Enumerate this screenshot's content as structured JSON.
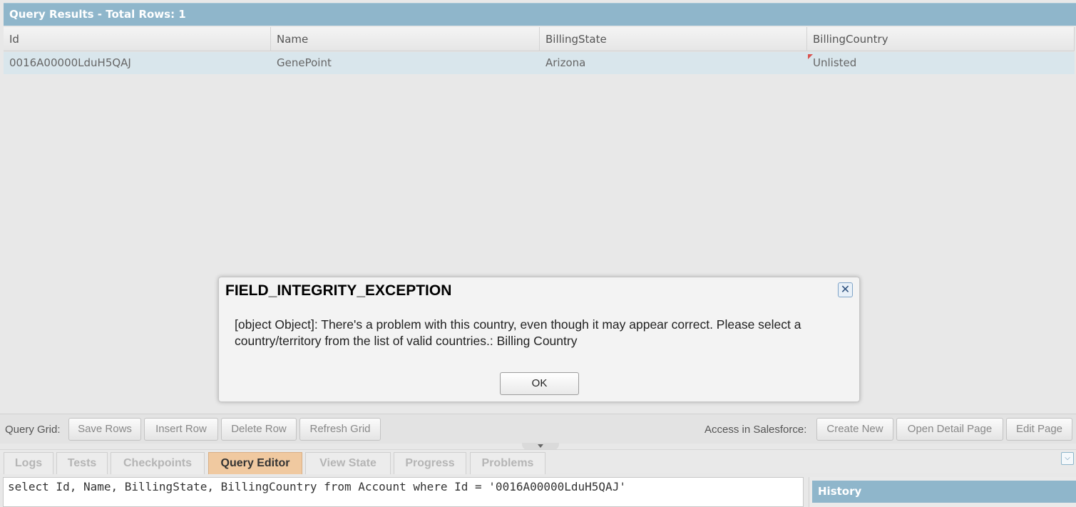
{
  "results": {
    "title": "Query Results - Total Rows: 1",
    "columns": [
      "Id",
      "Name",
      "BillingState",
      "BillingCountry"
    ],
    "rows": [
      [
        "0016A00000LduH5QAJ",
        "GenePoint",
        "Arizona",
        "Unlisted"
      ]
    ]
  },
  "toolbar": {
    "query_grid_label": "Query Grid:",
    "save_rows": "Save Rows",
    "insert_row": "Insert Row",
    "delete_row": "Delete Row",
    "refresh_grid": "Refresh Grid",
    "access_label": "Access in Salesforce:",
    "create_new": "Create New",
    "open_detail_page": "Open Detail Page",
    "edit_page": "Edit Page"
  },
  "tabs": [
    {
      "label": "Logs",
      "active": false
    },
    {
      "label": "Tests",
      "active": false
    },
    {
      "label": "Checkpoints",
      "active": false
    },
    {
      "label": "Query Editor",
      "active": true
    },
    {
      "label": "View State",
      "active": false
    },
    {
      "label": "Progress",
      "active": false
    },
    {
      "label": "Problems",
      "active": false
    }
  ],
  "editor": {
    "query": "select Id, Name, BillingState, BillingCountry from Account where Id = '0016A00000LduH5QAJ'"
  },
  "history": {
    "title": "History"
  },
  "dialog": {
    "title": "FIELD_INTEGRITY_EXCEPTION",
    "message": "[object Object]: There's a problem with this country, even though it may appear correct. Please select a country/territory from the list of valid countries.: Billing Country",
    "ok_label": "OK",
    "close_icon": "close-icon"
  },
  "colors": {
    "header_blue": "#8fb6cb",
    "selected_row": "#d9e6ec",
    "active_tab": "#f0c9a0",
    "dirty_marker": "#d9534f"
  }
}
